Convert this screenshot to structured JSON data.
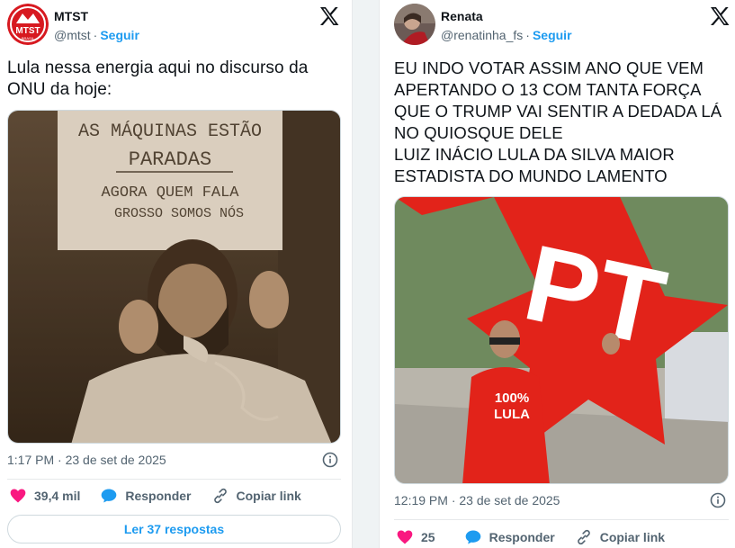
{
  "tweets": [
    {
      "author": {
        "display_name": "MTST",
        "handle": "@mtst",
        "follow_label": "Seguir",
        "avatar_text": "MTST",
        "avatar_subtext": "BRASIL",
        "avatar_color": "#d71920"
      },
      "text": "Lula nessa energia aqui no discurso da ONU da hoje:",
      "media": {
        "sign_lines": [
          "AS MÁQUINAS ESTÃO",
          "PARADAS",
          "AGORA QUEM FALA",
          "GROSSO SOMOS NÓS"
        ]
      },
      "timestamp": "1:17 PM · 23 de set de 2025",
      "likes": "39,4 mil",
      "reply_label": "Responder",
      "copy_label": "Copiar link",
      "read_replies_label": "Ler 37 respostas"
    },
    {
      "author": {
        "display_name": "Renata",
        "handle": "@renatinha_fs",
        "follow_label": "Seguir"
      },
      "text_lines": [
        "EU INDO VOTAR ASSIM ANO QUE VEM",
        "APERTANDO O 13 COM TANTA FORÇA",
        "QUE O TRUMP VAI SENTIR A DEDADA LÁ",
        "NO QUIOSQUE DELE",
        "LUIZ INÁCIO LULA DA SILVA MAIOR",
        "ESTADISTA DO MUNDO LAMENTO"
      ],
      "media": {
        "star_text": "PT",
        "shirt_line1": "100%",
        "shirt_line2": "LULA"
      },
      "timestamp": "12:19 PM · 23 de set de 2025",
      "likes": "25",
      "reply_label": "Responder",
      "copy_label": "Copiar link"
    }
  ],
  "colors": {
    "like": "#f91880",
    "reply": "#1d9bf0",
    "link": "#1d9bf0",
    "pt_red": "#e2231a"
  }
}
